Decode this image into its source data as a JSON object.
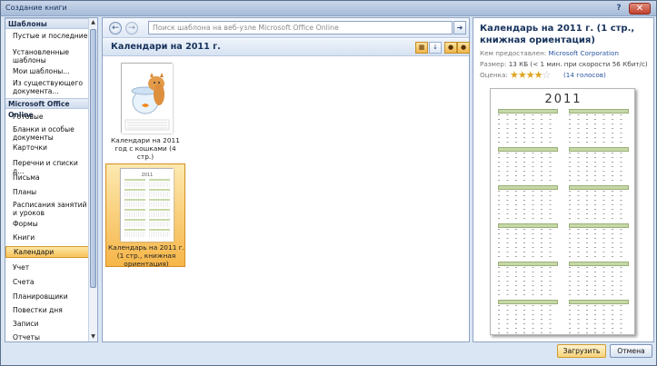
{
  "window": {
    "title": "Создание книги",
    "close_icon": "close-icon",
    "help_icon": "help-icon"
  },
  "sidebar": {
    "header": "Шаблоны",
    "items": [
      "Пустые и последние",
      "Установленные шаблоны",
      "Мои шаблоны...",
      "Из существующего документа..."
    ],
    "online_header": "Microsoft Office Online",
    "online_items": [
      "Готовые",
      "Бланки и особые документы",
      "Карточки",
      "Перечни и списки д...",
      "Письма",
      "Планы",
      "Расписания занятий и уроков",
      "Формы",
      "Книги",
      "Календари",
      "Учет",
      "Счета",
      "Планировщики",
      "Повестки дня",
      "Записи",
      "Отчеты"
    ],
    "selected": "Календари"
  },
  "center": {
    "search_placeholder": "Поиск шаблона на веб-узле Microsoft Office Online",
    "section_title": "Календари на 2011 г.",
    "templates": [
      {
        "caption": "Календари на 2011 год с кошками (4 стр.)",
        "selected": false
      },
      {
        "caption": "Календарь на 2011 г. (1 стр., книжная ориентация)",
        "selected": true
      }
    ]
  },
  "preview": {
    "title": "Календарь на 2011 г. (1 стр., книжная ориентация)",
    "provider_label": "Кем предоставлен:",
    "provider": "Microsoft Corporation",
    "size_label": "Размер:",
    "size": "13 КБ (< 1 мин. при скорости 56 Кбит/с)",
    "rating_label": "Оценка:",
    "rating_stars": 4,
    "rating_max": 5,
    "votes": "(14 голосов)",
    "image_year": "2011"
  },
  "buttons": {
    "download": "Загрузить",
    "cancel": "Отмена"
  },
  "colors": {
    "accent": "#f6b649",
    "frame": "#dbe6f4",
    "link": "#2b56a3"
  }
}
